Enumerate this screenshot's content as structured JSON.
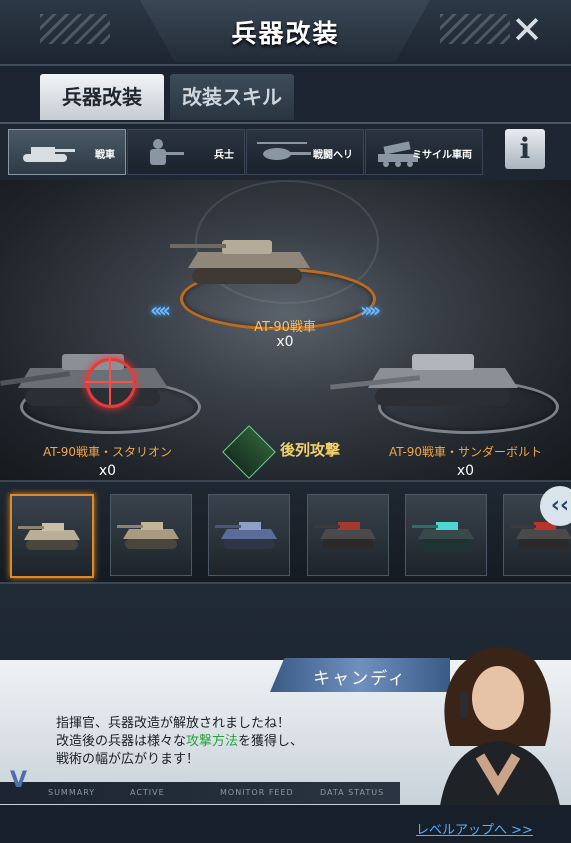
{
  "header": {
    "title": "兵器改装",
    "close_icon": "close-icon"
  },
  "tabs": [
    {
      "label": "兵器改装",
      "active": true
    },
    {
      "label": "改装スキル",
      "active": false
    }
  ],
  "categories": [
    {
      "label": "戦車",
      "icon": "tank-icon",
      "active": true
    },
    {
      "label": "兵士",
      "icon": "soldier-icon",
      "active": false
    },
    {
      "label": "戦闘ヘリ",
      "icon": "helicopter-icon",
      "active": false
    },
    {
      "label": "ミサイル車両",
      "icon": "missile-vehicle-icon",
      "active": false
    }
  ],
  "info_button": {
    "label": "i"
  },
  "stage": {
    "center": {
      "name": "AT-90戦車",
      "count": "x0"
    },
    "left": {
      "name": "AT-90戦車・スタリオン",
      "count": "x0"
    },
    "right": {
      "name": "AT-90戦車・サンダーボルト",
      "count": "x0"
    },
    "rear_attack_label": "後列攻撃",
    "arrows_left": "‹‹‹‹",
    "arrows_right": "››››"
  },
  "strip": {
    "selected_index": 0,
    "scroll_arrow": "‹‹"
  },
  "dialog": {
    "speaker": "キャンディ",
    "line1": "指揮官、兵器改造が解放されましたね！",
    "line2_before": "改造後の兵器は様々な",
    "line2_highlight": "攻撃方法",
    "line2_after": "を獲得し、",
    "line3": "戦術の幅が広がります！",
    "footer_labels": [
      "SUMMARY",
      "ACTIVE",
      "MONITOR FEED",
      "DATA STATUS"
    ],
    "footer_icon": "V"
  },
  "level_up_link": "レベルアップへ >>",
  "colors": {
    "accent_orange": "#e08a24",
    "link_blue": "#58aef7",
    "highlight_green": "#2aa140"
  }
}
